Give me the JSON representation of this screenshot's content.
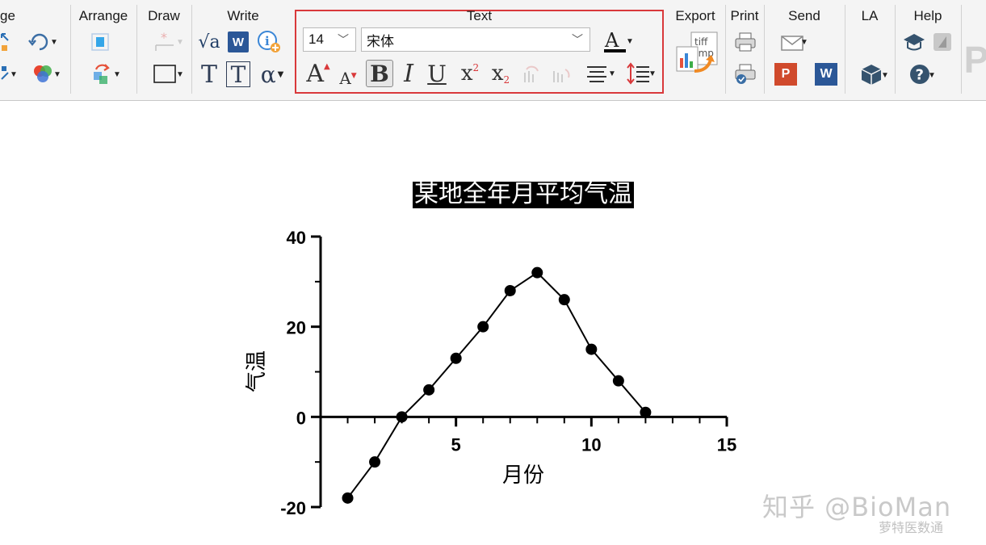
{
  "ribbon": {
    "groups": {
      "image": "ge",
      "arrange": "Arrange",
      "draw": "Draw",
      "write": "Write",
      "text": "Text",
      "export": "Export",
      "print": "Print",
      "send": "Send",
      "la": "LA",
      "help": "Help"
    },
    "text": {
      "font_size": "14",
      "font_name": "宋体",
      "font_color": "#000000",
      "highlight_color": "#d9393b"
    },
    "export_tiff": "tiff",
    "export_bmp": "bmp",
    "write_T": "T",
    "write_T_box": "T",
    "write_alpha": "α",
    "write_sqrt": "√a",
    "send_p": "P",
    "send_w": "W",
    "write_w": "W"
  },
  "chart_data": {
    "type": "line",
    "title": "某地全年月平均气温",
    "xlabel": "月份",
    "ylabel": "气温",
    "xlim": [
      0,
      15
    ],
    "ylim": [
      -20,
      40
    ],
    "x_ticks": [
      5,
      10,
      15
    ],
    "y_ticks": [
      -20,
      0,
      20,
      40
    ],
    "x_tick_labels": [
      "5",
      "10",
      "15"
    ],
    "y_tick_labels": [
      "-20",
      "0",
      "20",
      "40"
    ],
    "series": [
      {
        "x": [
          1,
          2,
          3,
          4,
          5,
          6,
          7,
          8,
          9,
          10,
          11,
          12
        ],
        "values": [
          -18,
          -10,
          0,
          6,
          13,
          20,
          28,
          32,
          26,
          15,
          8,
          1
        ]
      }
    ],
    "grid": false,
    "legend": "none"
  },
  "watermark": {
    "text": "知乎 @BioMan",
    "sub": "萝特医数通"
  }
}
